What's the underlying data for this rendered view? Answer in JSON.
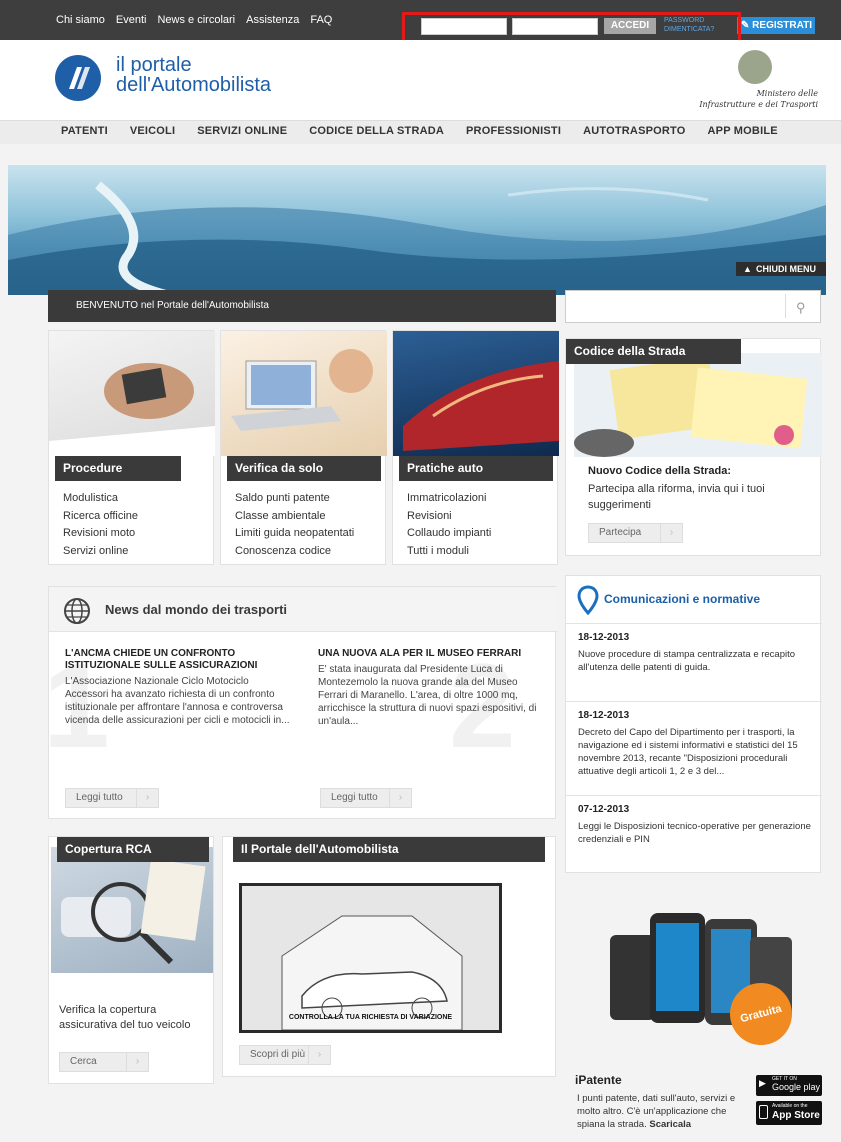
{
  "topbar": {
    "links": [
      "Chi siamo",
      "Eventi",
      "News e circolari",
      "Assistenza",
      "FAQ"
    ],
    "login_button": "ACCEDI",
    "password_link_line1": "PASSWORD",
    "password_link_line2": "DIMENTICATA?",
    "register_button": "REGISTRATI"
  },
  "header": {
    "logo_line1": "il portale",
    "logo_line2": "dell'Automobilista",
    "ministero_line1": "Ministero delle",
    "ministero_line2": "Infrastrutture e dei Trasporti"
  },
  "nav": [
    "PATENTI",
    "VEICOLI",
    "SERVIZI ONLINE",
    "CODICE DELLA STRADA",
    "PROFESSIONISTI",
    "AUTOTRASPORTO",
    "APP MOBILE"
  ],
  "banner": {
    "close_menu": "CHIUDI MENU"
  },
  "welcome": "BENVENUTO nel Portale dell'Automobilista",
  "cards": [
    {
      "title": "Procedure",
      "links": [
        "Modulistica",
        "Ricerca officine",
        "Revisioni moto",
        "Servizi online"
      ]
    },
    {
      "title": "Verifica da solo",
      "links": [
        "Saldo punti patente",
        "Classe ambientale",
        "Limiti guida neopatentati",
        "Conoscenza codice"
      ]
    },
    {
      "title": "Pratiche auto",
      "links": [
        "Immatricolazioni",
        "Revisioni",
        "Collaudo impianti",
        "Tutti i moduli"
      ]
    }
  ],
  "codice": {
    "title": "Codice della Strada",
    "heading": "Nuovo Codice della Strada:",
    "text": "Partecipa alla riforma, invia qui i tuoi suggerimenti",
    "button": "Partecipa"
  },
  "news": {
    "title": "News dal mondo dei trasporti",
    "items": [
      {
        "title_line1": "L'ANCMA CHIEDE UN CONFRONTO",
        "title_line2": "ISTITUZIONALE SULLE ASSICURAZIONI",
        "body": "L'Associazione Nazionale Ciclo Motociclo Accessori ha avanzato richiesta di un confronto istituzionale per affrontare l'annosa e controversa vicenda delle assicurazioni per cicli e motocicli in...",
        "button": "Leggi tutto"
      },
      {
        "title_line1": "UNA NUOVA ALA PER IL MUSEO FERRARI",
        "title_line2": "",
        "body": "E' stata inaugurata dal Presidente Luca di Montezemolo la nuova grande ala del Museo Ferrari di Maranello. L'area, di oltre 1000 mq, arricchisce la struttura di nuovi spazi espositivi, di un'aula...",
        "button": "Leggi tutto"
      }
    ]
  },
  "comunicazioni": {
    "title": "Comunicazioni e normative",
    "items": [
      {
        "date": "18-12-2013",
        "text": "Nuove procedure di stampa centralizzata e recapito all'utenza delle patenti di guida."
      },
      {
        "date": "18-12-2013",
        "text": "Decreto del Capo del Dipartimento per i trasporti, la navigazione ed i sistemi informativi e statistici del 15 novembre 2013, recante \"Disposizioni procedurali attuative degli articoli 1, 2 e 3 del..."
      },
      {
        "date": "07-12-2013",
        "text": "Leggi le Disposizioni tecnico-operative per generazione credenziali e PIN"
      }
    ]
  },
  "rca": {
    "title": "Copertura RCA",
    "text": "Verifica la copertura assicurativa del tuo veicolo",
    "button": "Cerca"
  },
  "portale": {
    "title": "Il Portale dell'Automobilista",
    "video_caption": "CONTROLLA LA TUA RICHIESTA DI VARIAZIONE",
    "button": "Scopri di più"
  },
  "ipatente": {
    "badge": "Gratuita",
    "title": "iPatente",
    "text": "I punti patente, dati sull'auto, servizi e molto altro. C'è un'applicazione che spiana la strada.",
    "download": "Scaricala",
    "google_small": "GET IT ON",
    "google_big": "Google play",
    "apple_small": "Available on the",
    "apple_big": "App Store"
  }
}
